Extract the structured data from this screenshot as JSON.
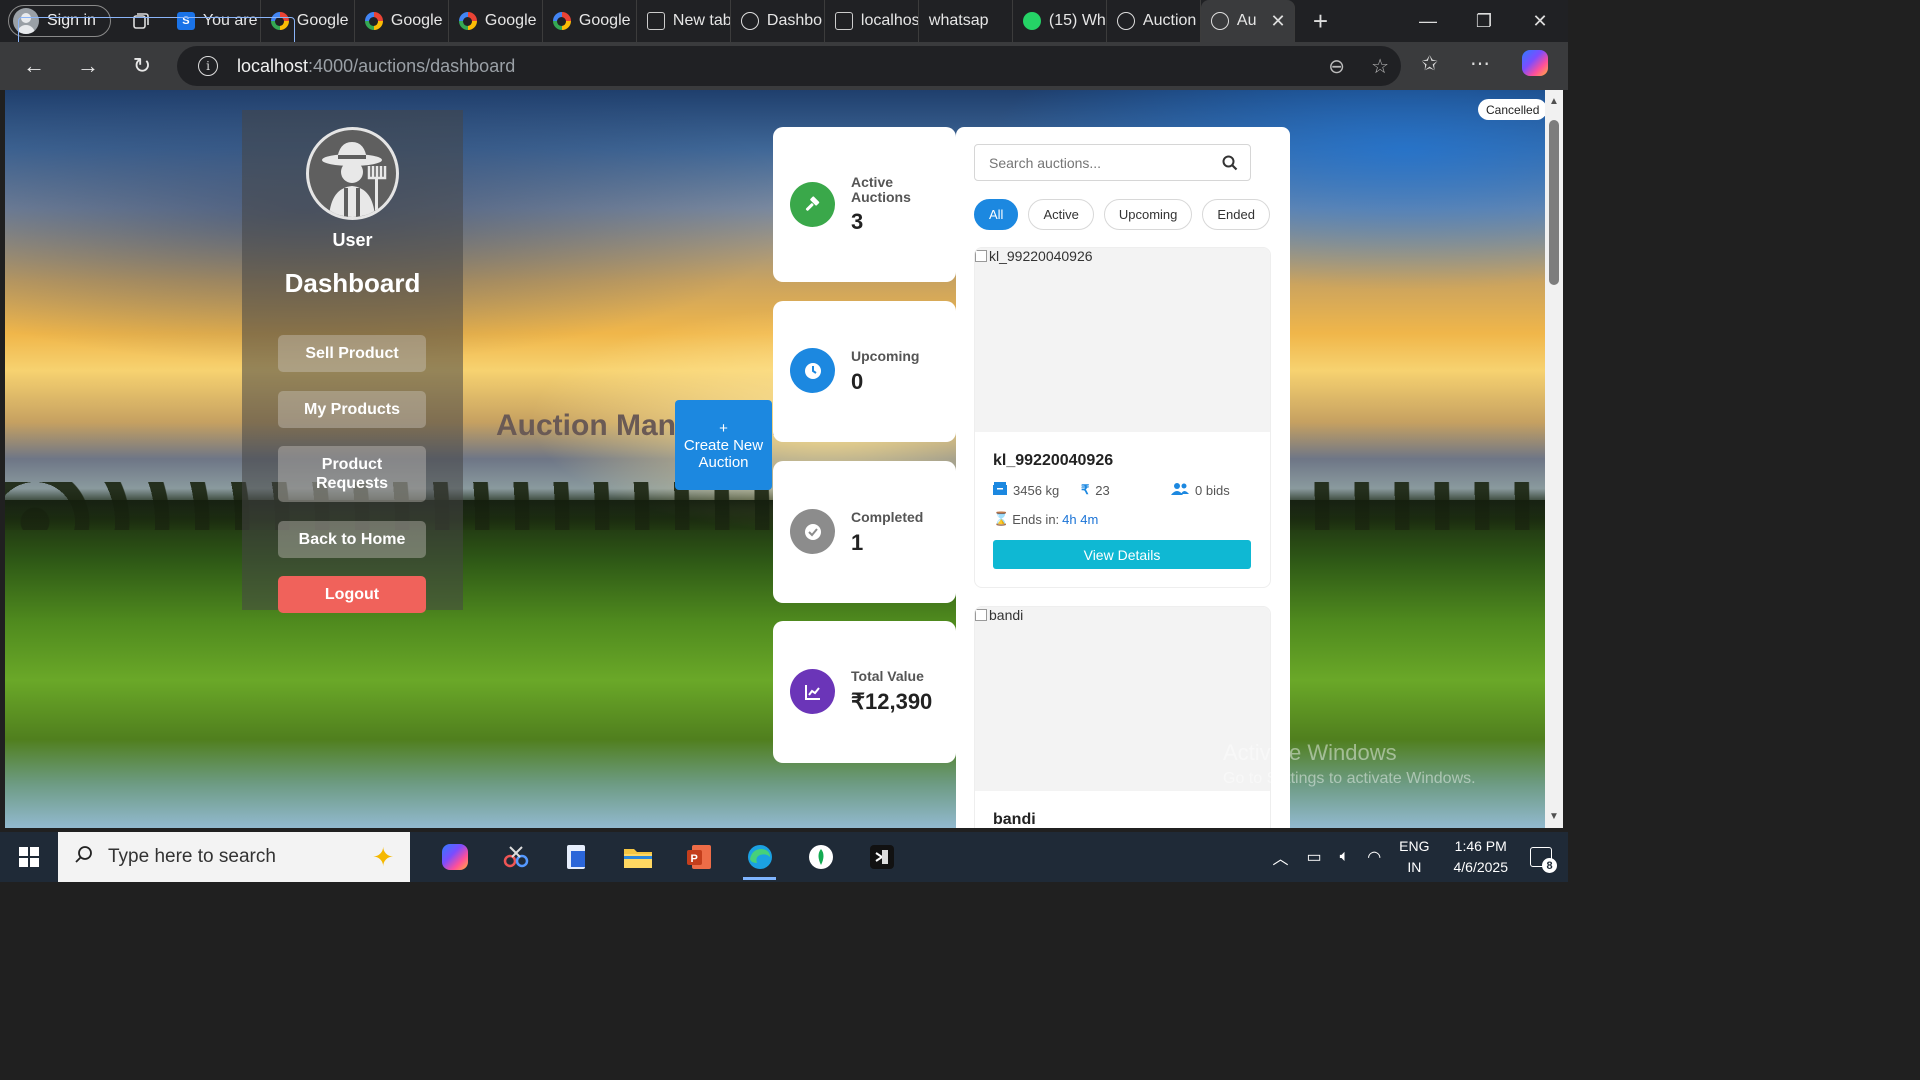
{
  "browser": {
    "signin_label": "Sign in",
    "tabs": [
      {
        "label": "You are",
        "icon": "s-icon"
      },
      {
        "label": "Google",
        "icon": "google-icon"
      },
      {
        "label": "Google",
        "icon": "google-icon"
      },
      {
        "label": "Google",
        "icon": "google-icon"
      },
      {
        "label": "Google",
        "icon": "google-icon"
      },
      {
        "label": "New tab",
        "icon": "newtab-icon"
      },
      {
        "label": "Dashbo",
        "icon": "globe-icon"
      },
      {
        "label": "localhos",
        "icon": "page-icon"
      },
      {
        "label": "whatsap",
        "icon": "search-icon"
      },
      {
        "label": "(15) Wh",
        "icon": "whatsapp-icon"
      },
      {
        "label": "Auction",
        "icon": "globe-icon"
      },
      {
        "label": "Au",
        "icon": "globe-icon",
        "active": true
      }
    ],
    "url_host": "localhost",
    "url_path": ":4000/auctions/dashboard"
  },
  "sidebar": {
    "user_label": "User",
    "dashboard_label": "Dashboard",
    "buttons": {
      "sell": "Sell Product",
      "my_products": "My Products",
      "product_requests": "Product Requests",
      "back_home": "Back to Home",
      "logout": "Logout"
    }
  },
  "main": {
    "title": "Auction Management",
    "create_plus": "+",
    "create_label": "Create New Auction"
  },
  "stats": [
    {
      "label": "Active Auctions",
      "value": "3",
      "color": "#3aa84a",
      "icon": "gavel-icon"
    },
    {
      "label": "Upcoming",
      "value": "0",
      "color": "#1c88e0",
      "icon": "clock-icon"
    },
    {
      "label": "Completed",
      "value": "1",
      "color": "#8c8c8c",
      "icon": "check-circle-icon"
    },
    {
      "label": "Total Value",
      "value": "₹12,390",
      "color": "#6b35b8",
      "icon": "chart-line-icon"
    }
  ],
  "auctions": {
    "search_placeholder": "Search auctions...",
    "filters": [
      "All",
      "Active",
      "Upcoming",
      "Ended"
    ],
    "active_filter": "All",
    "cards": [
      {
        "image_alt": "kl_99220040926",
        "name": "kl_99220040926",
        "quantity": "3456 kg",
        "price": "23",
        "bids": "0 bids",
        "ends_label": "Ends in:",
        "ends_value": "4h 4m",
        "button": "View Details"
      },
      {
        "image_alt": "bandi",
        "name": "bandi"
      }
    ]
  },
  "toast": "Cancelled",
  "watermark": {
    "line1": "Activate Windows",
    "line2": "Go to Settings to activate Windows."
  },
  "taskbar": {
    "search_placeholder": "Type here to search",
    "lang_line1": "ENG",
    "lang_line2": "IN",
    "time": "1:46 PM",
    "date": "4/6/2025",
    "notification_count": "8"
  }
}
